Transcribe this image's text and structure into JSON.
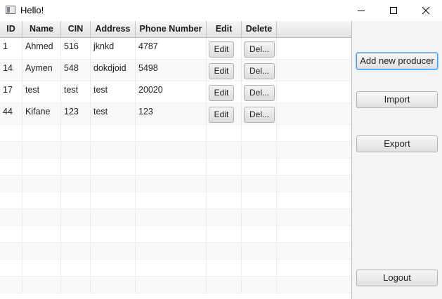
{
  "window": {
    "title": "Hello!"
  },
  "table": {
    "columns": [
      "ID",
      "Name",
      "CIN",
      "Address",
      "Phone Number",
      "Edit",
      "Delete"
    ],
    "rows": [
      {
        "id": "1",
        "name": "Ahmed",
        "cin": "516",
        "address": "jknkd",
        "phone": "4787",
        "edit": "Edit",
        "delete": "Del..."
      },
      {
        "id": "14",
        "name": "Aymen",
        "cin": "548",
        "address": "dokdjoid",
        "phone": "5498",
        "edit": "Edit",
        "delete": "Del..."
      },
      {
        "id": "17",
        "name": "test",
        "cin": "test",
        "address": "test",
        "phone": "20020",
        "edit": "Edit",
        "delete": "Del..."
      },
      {
        "id": "44",
        "name": "Kifane",
        "cin": "123",
        "address": "test",
        "phone": "123",
        "edit": "Edit",
        "delete": "Del..."
      }
    ]
  },
  "sidebar": {
    "add_label": "Add new producer",
    "import_label": "Import",
    "export_label": "Export",
    "logout_label": "Logout"
  }
}
